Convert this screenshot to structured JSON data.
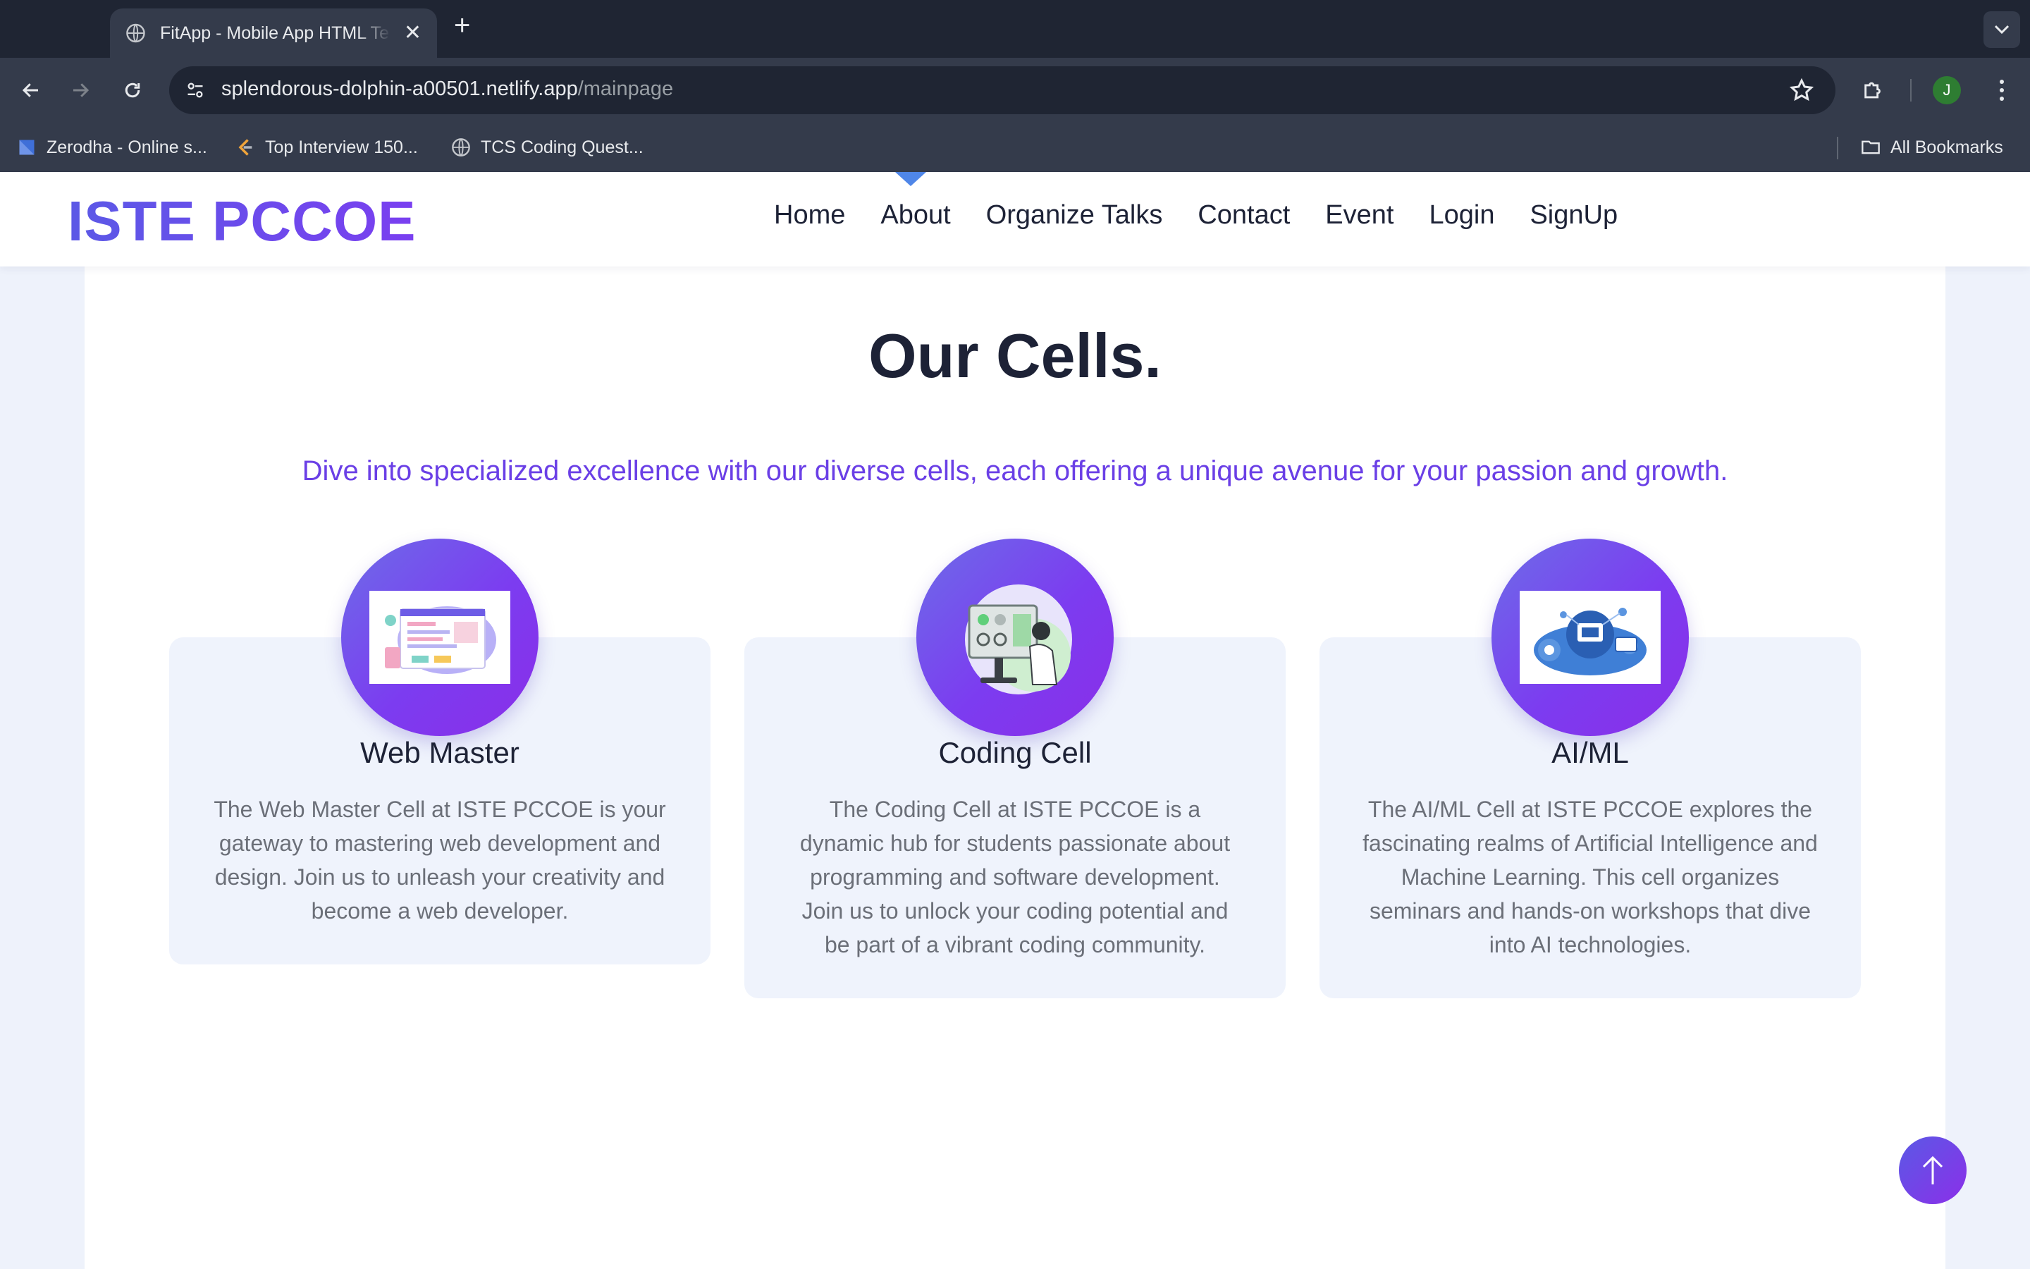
{
  "browser": {
    "tab_title": "FitApp - Mobile App HTML Te",
    "new_tab_label": "+",
    "url_domain": "splendorous-dolphin-a00501.netlify.app",
    "url_path": "/mainpage",
    "profile_initial": "J",
    "bookmarks": [
      {
        "label": "Zerodha - Online s...",
        "icon": "zerodha-icon"
      },
      {
        "label": "Top Interview 150...",
        "icon": "leetcode-icon"
      },
      {
        "label": "TCS Coding Quest...",
        "icon": "globe-icon"
      }
    ],
    "all_bookmarks_label": "All Bookmarks"
  },
  "site": {
    "logo": "ISTE PCCOE",
    "nav": [
      "Home",
      "About",
      "Organize Talks",
      "Contact",
      "Event",
      "Login",
      "SignUp"
    ],
    "section_title": "Our Cells.",
    "section_subtitle": "Dive into specialized excellence with our diverse cells, each offering a unique avenue for your passion and growth.",
    "cells": [
      {
        "title": "Web Master",
        "description": "The Web Master Cell at ISTE PCCOE is your gateway to mastering web development and design. Join us to unleash your creativity and become a web developer.",
        "illustration": "web-design-illustration"
      },
      {
        "title": "Coding Cell",
        "description": "The Coding Cell at ISTE PCCOE is a dynamic hub for students passionate about programming and software development. Join us to unlock your coding potential and be part of a vibrant coding community.",
        "illustration": "coding-illustration"
      },
      {
        "title": "AI/ML",
        "description": "The AI/ML Cell at ISTE PCCOE explores the fascinating realms of Artificial Intelligence and Machine Learning. This cell organizes seminars and hands-on workshops that dive into AI technologies.",
        "illustration": "ai-ml-illustration"
      }
    ]
  },
  "colors": {
    "accent": "#6a3fe6",
    "accent_blue": "#5b59e6",
    "heading": "#1d2236",
    "body_text": "#6b6f78",
    "card_bg": "#eff3fc"
  }
}
